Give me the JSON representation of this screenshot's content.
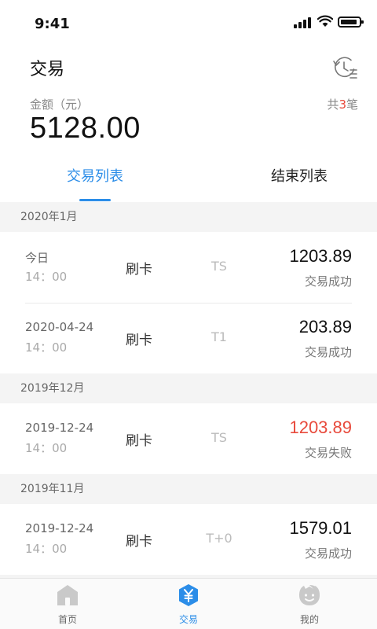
{
  "status_bar": {
    "time": "9:41"
  },
  "header": {
    "title": "交易",
    "history_icon": "history-list-icon"
  },
  "summary": {
    "amount_label": "金额（元）",
    "amount": "5128.00",
    "count_prefix": "共",
    "count": "3",
    "count_suffix": "笔"
  },
  "tabs": [
    {
      "label": "交易列表",
      "active": true
    },
    {
      "label": "结束列表",
      "active": false
    }
  ],
  "sections": [
    {
      "title": "2020年1月",
      "rows": [
        {
          "date": "今日",
          "time": "14：00",
          "type": "刷卡",
          "settle": "TS",
          "amount": "1203.89",
          "status": "交易成功",
          "failed": false
        },
        {
          "date": "2020-04-24",
          "time": "14：00",
          "type": "刷卡",
          "settle": "T1",
          "amount": "203.89",
          "status": "交易成功",
          "failed": false
        }
      ]
    },
    {
      "title": "2019年12月",
      "rows": [
        {
          "date": "2019-12-24",
          "time": "14：00",
          "type": "刷卡",
          "settle": "TS",
          "amount": "1203.89",
          "status": "交易失败",
          "failed": true
        }
      ]
    },
    {
      "title": "2019年11月",
      "rows": [
        {
          "date": "2019-12-24",
          "time": "14：00",
          "type": "刷卡",
          "settle": "T+0",
          "amount": "1579.01",
          "status": "交易成功",
          "failed": false
        }
      ]
    }
  ],
  "bottom_nav": [
    {
      "label": "首页",
      "icon": "home-icon",
      "active": false
    },
    {
      "label": "交易",
      "icon": "yen-icon",
      "active": true
    },
    {
      "label": "我的",
      "icon": "profile-face-icon",
      "active": false
    }
  ],
  "colors": {
    "accent": "#2b8de8",
    "danger": "#e84a3c",
    "muted": "#888888"
  }
}
